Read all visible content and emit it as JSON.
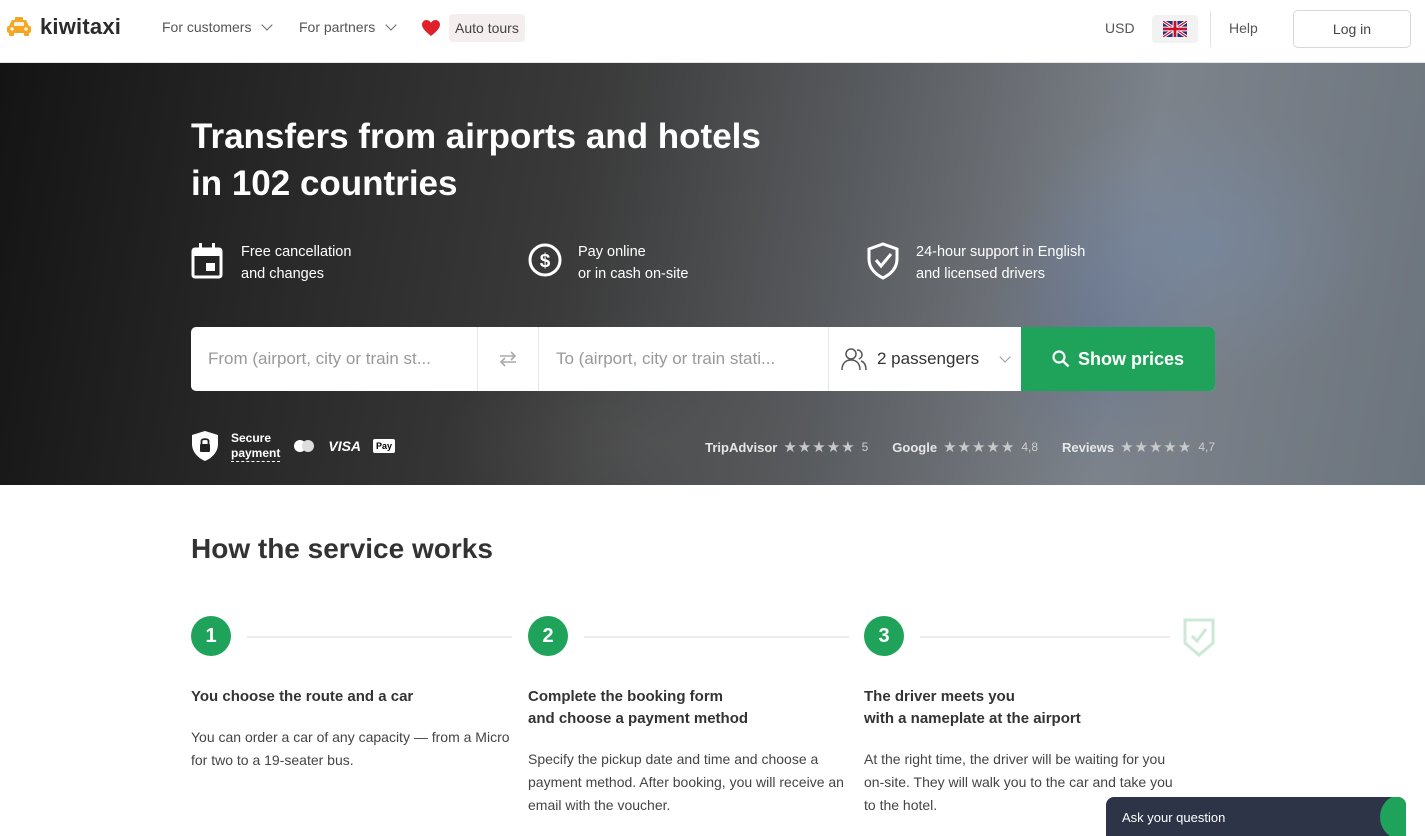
{
  "header": {
    "logo_text": "kiwitaxi",
    "nav": [
      {
        "label": "For customers"
      },
      {
        "label": "For partners"
      }
    ],
    "auto_tours_label": "Auto tours",
    "currency": "USD",
    "language_flag": "uk-flag-icon",
    "help_label": "Help",
    "login_label": "Log in"
  },
  "hero": {
    "title_line1": "Transfers from airports and hotels",
    "title_line2": "in 102 countries",
    "features": [
      {
        "icon": "calendar-icon",
        "line1": "Free cancellation",
        "line2": "and changes"
      },
      {
        "icon": "dollar-icon",
        "line1": "Pay online",
        "line2": "or in cash on-site"
      },
      {
        "icon": "shield-check-icon",
        "line1": "24-hour support in English",
        "line2": "and licensed drivers"
      }
    ],
    "search": {
      "from_placeholder": "From (airport, city or train st...",
      "to_placeholder": "To (airport, city or train stati...",
      "passengers": "2 passengers",
      "show_prices": "Show prices"
    },
    "secure_line1": "Secure",
    "secure_line2": "payment",
    "payment_methods": [
      "Mastercard",
      "VISA",
      "Pay"
    ],
    "ratings": [
      {
        "source": "TripAdvisor",
        "stars": "★★★★★",
        "value": "5"
      },
      {
        "source": "Google",
        "stars": "★★★★★",
        "value": "4,8"
      },
      {
        "source": "Reviews",
        "stars": "★★★★★",
        "value": "4,7"
      }
    ]
  },
  "how": {
    "title": "How the service works",
    "steps": [
      {
        "number": "1",
        "title_line1": "You choose the route and a car",
        "title_line2": "",
        "text": "You can order a car of any capacity — from a Micro for two to a 19-seater bus."
      },
      {
        "number": "2",
        "title_line1": "Complete the booking form",
        "title_line2": "and choose a payment method",
        "text": "Specify the pickup date and time and choose a payment method. After booking, you will receive an email with the voucher."
      },
      {
        "number": "3",
        "title_line1": "The driver meets you",
        "title_line2": "with a nameplate at the airport",
        "text": "At the right time, the driver will be waiting for you on-site. They will walk you to the car and take you to the hotel."
      }
    ]
  },
  "chat": {
    "label": "Ask your question"
  },
  "colors": {
    "brand_green": "#1fa35a",
    "chat_bg": "#2d3447",
    "logo_orange": "#f5a623"
  }
}
